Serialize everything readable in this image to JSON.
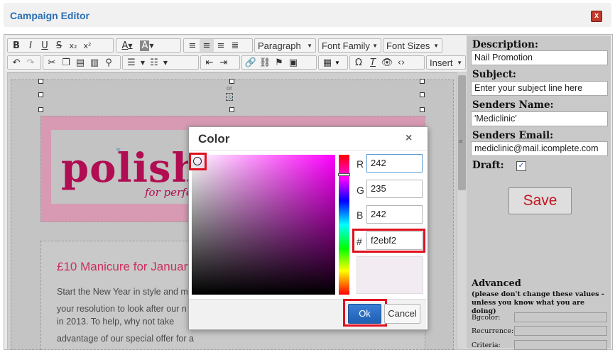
{
  "window": {
    "title": "Campaign Editor",
    "close_icon": "close-icon"
  },
  "toolbar": {
    "row1": [
      {
        "name": "bold-button",
        "glyph": "B"
      },
      {
        "name": "italic-button",
        "glyph": "I"
      },
      {
        "name": "underline-button",
        "glyph": "U"
      },
      {
        "name": "strikethrough-button",
        "glyph": "S"
      },
      {
        "name": "subscript-button",
        "glyph": "x₂"
      },
      {
        "name": "superscript-button",
        "glyph": "x²"
      }
    ],
    "text_color_glyph": "A",
    "bg_color_glyph": "A",
    "align_icons": [
      "align-left-icon",
      "align-center-icon",
      "align-right-icon",
      "align-justify-icon"
    ],
    "paragraph_label": "Paragraph",
    "font_family_label": "Font Family",
    "font_sizes_label": "Font Sizes",
    "row2_icons": [
      "undo-icon",
      "redo-icon",
      "cut-icon",
      "copy-icon",
      "paste-icon",
      "paste-text-icon",
      "find-icon",
      "bullet-list-icon",
      "numbered-list-icon",
      "outdent-icon",
      "indent-icon",
      "link-icon",
      "unlink-icon",
      "anchor-icon",
      "image-icon",
      "table-icon",
      "special-char-icon",
      "clear-format-icon",
      "preview-icon",
      "source-code-icon"
    ],
    "omega_glyph": "Ω",
    "insert_label": "Insert"
  },
  "editor": {
    "or_text": "or",
    "logo_text": "polishe",
    "tagline": "for perfecti",
    "headline": "£10 Manicure for January",
    "body_lines": [
      "Start the New Year in style and m",
      "your resolution to look after our n",
      "in 2013. To help, why not take",
      "advantage of our special offer for a"
    ]
  },
  "sidebar": {
    "description_label": "Description:",
    "description_value": "Nail Promotion",
    "subject_label": "Subject:",
    "subject_value": "Enter your subject line here",
    "senders_name_label": "Senders Name:",
    "senders_name_value": "'Mediclinic'",
    "senders_email_label": "Senders Email:",
    "senders_email_value": "mediclinic@mail.icomplete.com",
    "draft_label": "Draft:",
    "draft_checked": true,
    "check_glyph": "✓",
    "save_label": "Save",
    "advanced_label": "Advanced",
    "advanced_note": "(please don't change these values - unless you know what you are doing)",
    "bgcolor_label": "Bgcolor:",
    "recurrence_label": "Recurrence:",
    "criteria_label": "Criteria:"
  },
  "color_dialog": {
    "title": "Color",
    "close_glyph": "×",
    "r_label": "R",
    "r_value": "242",
    "g_label": "G",
    "g_value": "235",
    "b_label": "B",
    "b_value": "242",
    "hex_label": "#",
    "hex_value": "f2ebf2",
    "preview_color": "#f2ebf2",
    "ok_label": "Ok",
    "cancel_label": "Cancel"
  },
  "colors": {
    "accent_blue": "#2a6fb4",
    "highlight_red": "#e0101e",
    "brand_pink": "#b00d52",
    "save_red": "#c4161c"
  }
}
